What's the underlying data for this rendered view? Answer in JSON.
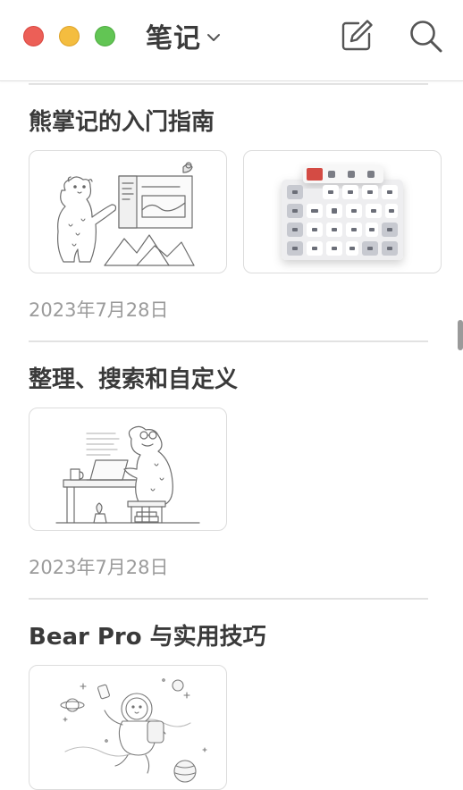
{
  "window": {
    "title": "笔记",
    "controls": [
      "close",
      "minimize",
      "zoom"
    ],
    "colors": {
      "close": "#ec5f57",
      "minimize": "#f4bd3f",
      "zoom": "#62c554"
    }
  },
  "toolbar": {
    "title_menu_icon": "chevron-down-icon",
    "compose_icon": "compose-icon",
    "search_icon": "search-icon"
  },
  "notes": [
    {
      "title": "熊掌记的入门指南",
      "date": "2023年7月28日",
      "thumbnails": [
        "bear-presenting-illustration",
        "formatting-toolbar-image"
      ]
    },
    {
      "title": "整理、搜索和自定义",
      "date": "2023年7月28日",
      "thumbnails": [
        "bear-at-desk-illustration"
      ]
    },
    {
      "title": "Bear Pro 与实用技巧",
      "date": "",
      "thumbnails": [
        "astronaut-bear-illustration"
      ]
    }
  ]
}
